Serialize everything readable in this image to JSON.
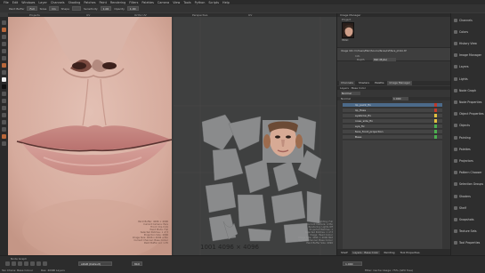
{
  "menubar": {
    "items": [
      "File",
      "Edit",
      "Windows",
      "Layer",
      "Channels",
      "Shading",
      "Patches",
      "Paint",
      "Rendering",
      "Filters",
      "Palettes",
      "Camera",
      "View",
      "Tools",
      "Python",
      "Scripts",
      "Help"
    ]
  },
  "toolbar": {
    "fields": [
      {
        "label": "Paint Buffer",
        "value": "Full"
      },
      {
        "label": "Sizes",
        "value": "On"
      },
      {
        "label": "Shape",
        "value": ""
      },
      {
        "label": "Sensitivity",
        "value": "1.00"
      },
      {
        "label": "Opacity",
        "value": "1.00"
      }
    ]
  },
  "view_tabs": {
    "items": [
      "Projects",
      "UV",
      "Ortho UV",
      "Perspective",
      "UV"
    ]
  },
  "viewport_face": {
    "info": [
      "Paint Buffer: 4096 × 4096",
      "Current Camera: Pers",
      "Front: Clip 0.01",
      "Paint Mode: Full",
      "Selected Patches: 1 of 3",
      "Projection Size: 4096",
      "Image Size: 4096 x 4096 ortho",
      "Current Channel: Base Colour",
      "Paint Buffer Lvl: 1.35"
    ]
  },
  "viewport_uv": {
    "uv_label": "1001 4096 × 4096",
    "info": [
      "Lighting: Full",
      "Current Camera: ortho",
      "Rendering: Lights Off",
      "Projected Patches: 1",
      "Selected Patches: 1 of 3",
      "Image: Head Colour",
      "Image Size: 4096 × 4096 8bit",
      "Current Channel: Base Colour",
      "Paint Buffer Size: 4096"
    ]
  },
  "image_manager": {
    "title": "Image Manager",
    "subtitle": "Project",
    "thumb_caption": "HEAD",
    "image_path": "Image Info: D:/Users/Mari/Source/faces/ref/face_photo.tif",
    "info_label": "Info",
    "depth_label": "Depth",
    "depth_value": "8bit (Byte)"
  },
  "layer_tabs": [
    "Channels",
    "Shaders",
    "Palette",
    "Image Manager"
  ],
  "layers_panel": {
    "header": "Layers : Base Color",
    "blend_mode": "Normal",
    "layer_values": {
      "opacity": "1.000"
    },
    "items": [
      {
        "name": "lip_paint_fix",
        "selected": true,
        "color": "#c0392b"
      },
      {
        "name": "lip_fixes",
        "selected": false,
        "color": "#c0392b"
      },
      {
        "name": "eyebrow_fix",
        "selected": false,
        "color": "#e0c040"
      },
      {
        "name": "nose_side_fix",
        "selected": false,
        "color": "#e0c040"
      },
      {
        "name": "eye_fix",
        "selected": false,
        "color": "#4caf50"
      },
      {
        "name": "face_front_projection",
        "selected": false,
        "color": "#4caf50"
      },
      {
        "name": "Base",
        "selected": false,
        "color": "#4caf50"
      }
    ]
  },
  "shelf_tabs": [
    "Shelf",
    "Layers : Base Color",
    "Painting",
    "Tool Properties"
  ],
  "right_shelf": {
    "items": [
      "Channels",
      "Colors",
      "History View",
      "Image Manager",
      "Layers",
      "Lights",
      "Node Graph",
      "Node Properties",
      "Object Properties",
      "Objects",
      "Painting",
      "Palettes",
      "Projectors",
      "Pattern Chooser",
      "Selection Groups",
      "Shaders",
      "Shelf",
      "Snapshots",
      "Texture Sets",
      "Tool Properties"
    ]
  },
  "bottom": {
    "node_graph_label": "Node Graph",
    "left_status": [
      "Tex Chans: Base Colour",
      "Res: 4096",
      "3 Layers"
    ],
    "color_field": "sRGB (Default)",
    "res_field": "8bit",
    "zoom_value": "1.000",
    "right_status": "Filter: Cache Usage: 75% (GPU free)"
  },
  "colors": {
    "accent": "#4c6a8a",
    "bg": "#3a3a3a"
  }
}
